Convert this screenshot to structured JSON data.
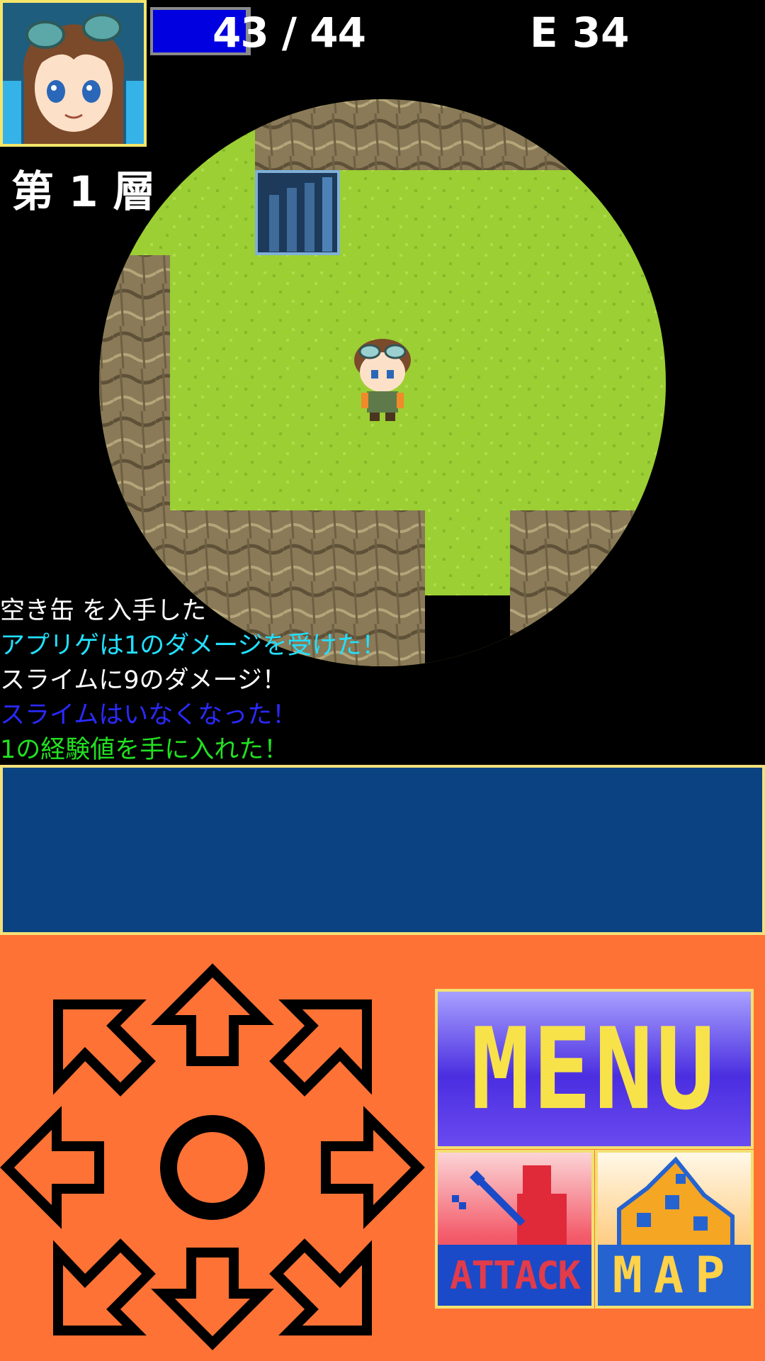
{
  "hud": {
    "hp_text": "43 / 44",
    "hp_current": 43,
    "hp_max": 44,
    "energy_text": "E 34",
    "floor_label": "第 1 層"
  },
  "log": [
    {
      "text": "空き缶 を入手した",
      "color": "#ffffff"
    },
    {
      "text": "アプリゲは1のダメージを受けた！",
      "color": "#22e0ff"
    },
    {
      "text": "スライムに9のダメージ！",
      "color": "#ffffff"
    },
    {
      "text": "スライムはいなくなった！",
      "color": "#2a2aff"
    },
    {
      "text": "1の経験値を手に入れた！",
      "color": "#22e022"
    }
  ],
  "buttons": {
    "menu_label": "MENU",
    "attack_label": "ATTACK",
    "map_label": "MAP"
  },
  "colors": {
    "grass": "#9acd32",
    "rock": "#8c7a55",
    "message_window": "#0b4382",
    "control_panel": "#ff7235",
    "frame": "#f3e17a"
  },
  "icons": [
    "portrait-avatar",
    "stairs-icon",
    "player-sprite",
    "arrow-up-icon",
    "arrow-down-icon",
    "arrow-left-icon",
    "arrow-right-icon",
    "arrow-diagonal-icon",
    "circle-center-icon",
    "sword-knight-icon",
    "map-castle-icon"
  ]
}
